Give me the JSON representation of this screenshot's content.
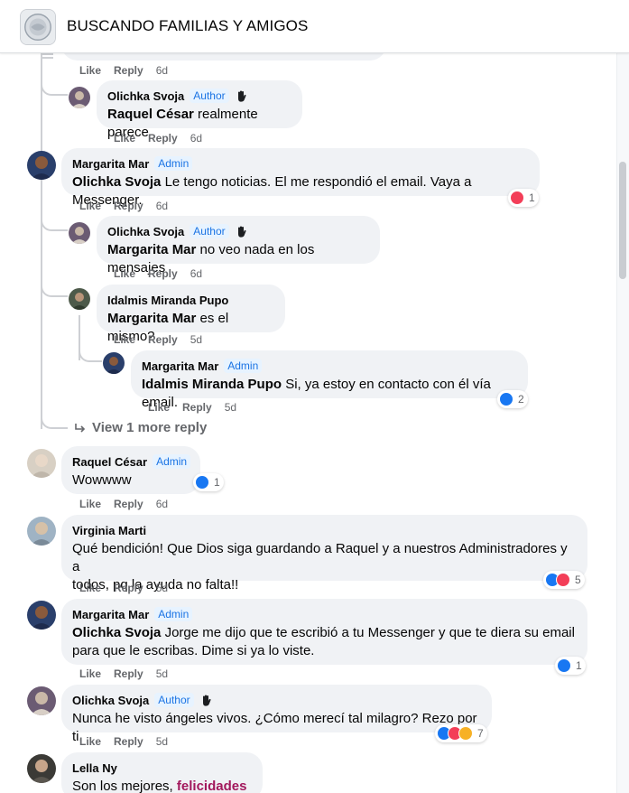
{
  "header": {
    "group_title": "BUSCANDO FAMILIAS Y AMIGOS"
  },
  "labels": {
    "like": "Like",
    "reply": "Reply"
  },
  "top_fragment": {
    "time": "6d"
  },
  "comments": [
    {
      "author": "Olichka Svoja",
      "badge": "Author",
      "mention": "Raquel César",
      "text": "realmente parece",
      "time": "6d"
    },
    {
      "author": "Margarita Mar",
      "badge": "Admin",
      "mention": "Olichka Svoja",
      "text": "Le tengo noticias. El me respondió el email. Vaya a Messenger.",
      "time": "6d",
      "reaction_count": "1"
    },
    {
      "author": "Olichka Svoja",
      "badge": "Author",
      "mention": "Margarita Mar",
      "text": "no veo nada en los mensajes",
      "time": "6d"
    },
    {
      "author": "Idalmis Miranda Pupo",
      "mention": "Margarita Mar",
      "text": "es el mismo?",
      "time": "5d"
    },
    {
      "author": "Margarita Mar",
      "badge": "Admin",
      "mention": "Idalmis Miranda Pupo",
      "text": "Si, ya estoy en contacto con él vía email.",
      "time": "5d",
      "reaction_count": "2"
    },
    {
      "author": "Raquel César",
      "badge": "Admin",
      "text": "Wowwww",
      "time": "6d",
      "reaction_count": "1"
    },
    {
      "author": "Virginia Marti",
      "text": "Qué bendición! Que Dios siga guardando a Raquel y a nuestros Administradores y a",
      "text2": "todos, pq la ayuda no falta!!",
      "time": "5d",
      "reaction_count": "5"
    },
    {
      "author": "Margarita Mar",
      "badge": "Admin",
      "mention": "Olichka Svoja",
      "text": "Jorge me dijo que te escribió a tu Messenger y que te diera su email",
      "text2": "para que le escribas. Dime si ya lo viste.",
      "time": "5d",
      "reaction_count": "1"
    },
    {
      "author": "Olichka Svoja",
      "badge": "Author",
      "text": "Nunca he visto ángeles vivos. ¿Cómo merecí tal milagro? Rezo por ti.",
      "time": "5d",
      "reaction_count": "7"
    },
    {
      "author": "Lella Ny",
      "text": "Son los mejores,",
      "highlight": "felicidades",
      "text_end": "!!"
    }
  ],
  "view_more": {
    "label": "View 1 more reply"
  },
  "colors": {
    "badge_text": "#1b74e4",
    "badge_bg": "#e7f3ff",
    "like_blue": "#1877f2",
    "love_red": "#f33e58",
    "care_yellow": "#f7b125",
    "highlight": "#a2185c"
  }
}
